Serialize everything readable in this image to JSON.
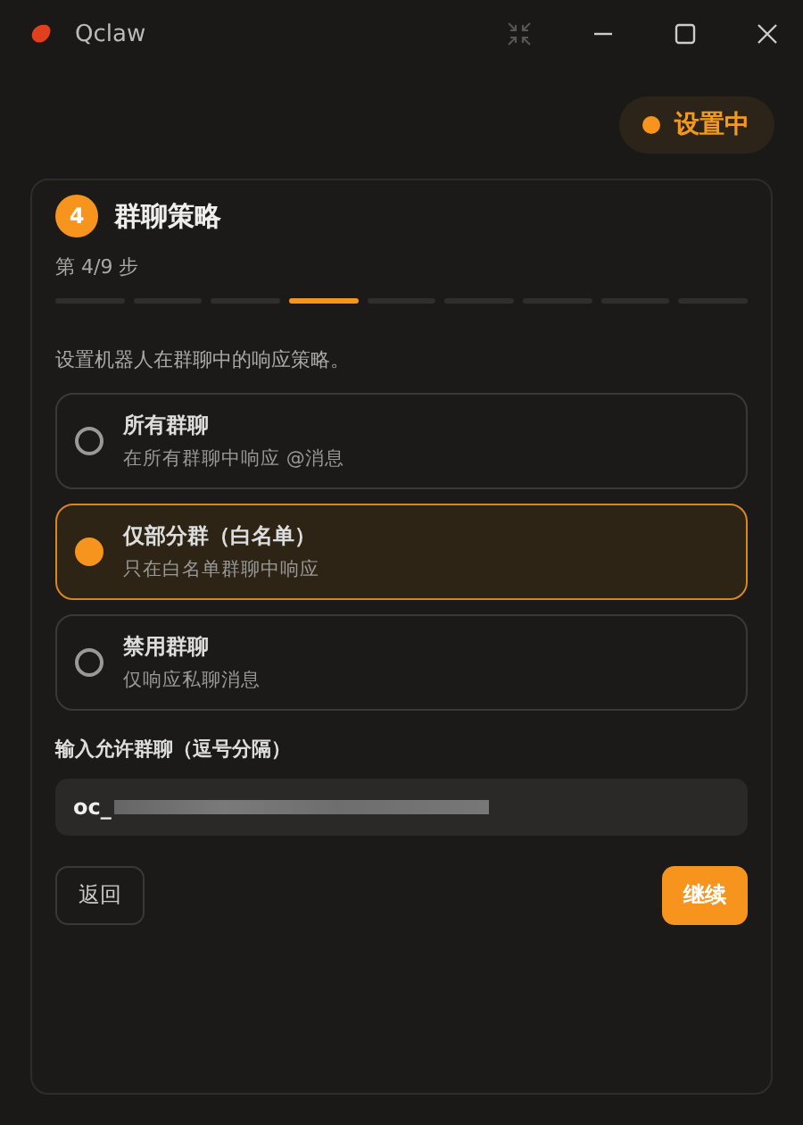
{
  "window": {
    "title": "Qclaw"
  },
  "status": {
    "label": "设置中"
  },
  "step": {
    "number": "4",
    "title": "群聊策略",
    "progress": "第 4/9 步",
    "segments": [
      {
        "selected": false
      },
      {
        "selected": false
      },
      {
        "selected": false
      },
      {
        "selected": true
      },
      {
        "selected": false
      },
      {
        "selected": false
      },
      {
        "selected": false
      },
      {
        "selected": false
      },
      {
        "selected": false
      }
    ]
  },
  "description": "设置机器人在群聊中的响应策略。",
  "options": [
    {
      "title": "所有群聊",
      "subtitle": "在所有群聊中响应 @消息",
      "selected": false
    },
    {
      "title": "仅部分群（白名单）",
      "subtitle": "只在白名单群聊中响应",
      "selected": true
    },
    {
      "title": "禁用群聊",
      "subtitle": "仅响应私聊消息",
      "selected": false
    }
  ],
  "field": {
    "label": "输入允许群聊（逗号分隔）",
    "value": "oc_"
  },
  "buttons": {
    "back": "返回",
    "next": "继续"
  }
}
